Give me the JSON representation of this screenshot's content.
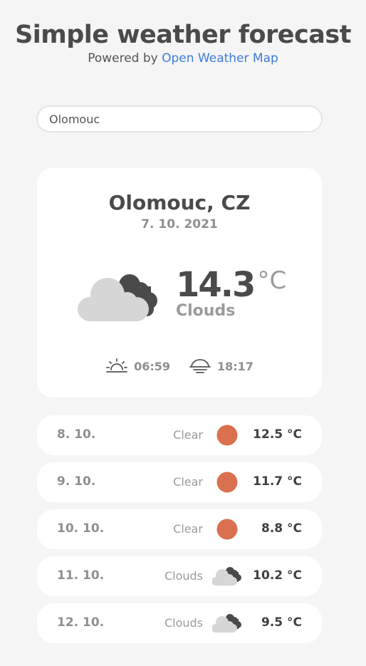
{
  "header": {
    "title": "Simple weather forecast",
    "powered_prefix": "Powered by",
    "powered_link": "Open Weather Map"
  },
  "search": {
    "value": "Olomouc"
  },
  "current": {
    "city": "Olomouc, CZ",
    "date": "7. 10. 2021",
    "temp": "14.3",
    "unit": "°C",
    "condition": "Clouds",
    "icon": "clouds-icon",
    "sunrise": "06:59",
    "sunset": "18:17"
  },
  "forecast": [
    {
      "date": "8. 10.",
      "condition": "Clear",
      "icon": "clear-icon",
      "temp": "12.5 °C"
    },
    {
      "date": "9. 10.",
      "condition": "Clear",
      "icon": "clear-icon",
      "temp": "11.7 °C"
    },
    {
      "date": "10. 10.",
      "condition": "Clear",
      "icon": "clear-icon",
      "temp": "8.8 °C"
    },
    {
      "date": "11. 10.",
      "condition": "Clouds",
      "icon": "clouds-icon",
      "temp": "10.2 °C"
    },
    {
      "date": "12. 10.",
      "condition": "Clouds",
      "icon": "clouds-icon",
      "temp": "9.5 °C"
    }
  ],
  "colors": {
    "clear": "#d9704f",
    "cloud_light": "#d6d6d6",
    "cloud_dark": "#4a4a4a",
    "link": "#3d7bd9"
  }
}
